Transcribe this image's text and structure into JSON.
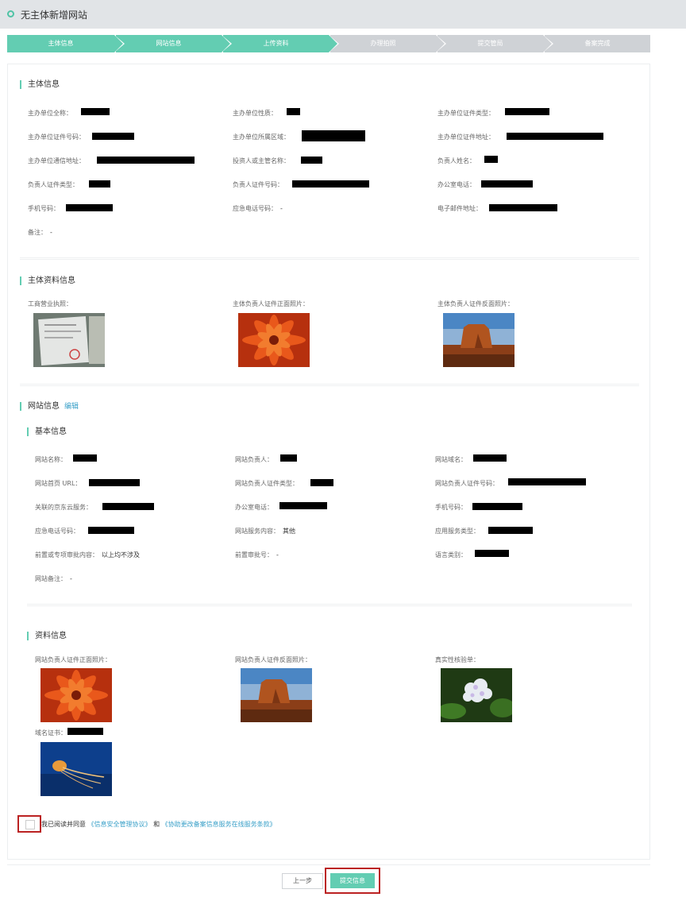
{
  "header": {
    "title": "无主体新增网站"
  },
  "steps": [
    {
      "label": "主体信息",
      "done": true
    },
    {
      "label": "网站信息",
      "done": true
    },
    {
      "label": "上传资料",
      "done": true
    },
    {
      "label": "办理拍照",
      "done": false
    },
    {
      "label": "提交管局",
      "done": false
    },
    {
      "label": "备案完成",
      "done": false
    }
  ],
  "colors": {
    "accent": "#63cdb2",
    "link": "#3aa0c8",
    "inactive_step": "#cfd2d6",
    "highlight_border": "#bb2222"
  },
  "subject_info": {
    "title": "主体信息",
    "fields": {
      "org_name": "主办单位全称：",
      "org_nature": "主办单位性质：",
      "org_cert_type": "主办单位证件类型：",
      "org_cert_no": "主办单位证件号码：",
      "org_region": "主办单位所属区域：",
      "org_cert_addr": "主办单位证件地址：",
      "org_mail_addr": "主办单位通信地址：",
      "investor": "投资人或主管名称：",
      "owner_name": "负责人姓名：",
      "owner_cert_type": "负责人证件类型：",
      "owner_cert_no": "负责人证件号码：",
      "office_phone": "办公室电话：",
      "mobile": "手机号码：",
      "emergency_phone": "应急电话号码：",
      "emergency_phone_value": "-",
      "email": "电子邮件地址：",
      "remark": "备注：",
      "remark_value": "-"
    }
  },
  "subject_docs": {
    "title": "主体资料信息",
    "items": {
      "license": "工商营业执照：",
      "cert_front": "主体负责人证件正面照片：",
      "cert_back": "主体负责人证件反面照片："
    }
  },
  "website_info": {
    "title": "网站信息",
    "edit": "编辑",
    "basic_title": "基本信息",
    "fields": {
      "site_name": "网站名称：",
      "site_owner": "网站负责人：",
      "domain": "网站域名：",
      "home_url": "网站首页 URL：",
      "owner_cert_type": "网站负责人证件类型：",
      "owner_cert_no": "网站负责人证件号码：",
      "jd_service": "关联的京东云服务：",
      "office_phone": "办公室电话：",
      "mobile": "手机号码：",
      "emergency_phone": "应急电话号码：",
      "service_content": "网站服务内容：",
      "service_content_value": "其他",
      "app_service_type": "应用服务类型：",
      "pre_approval": "前置或专项审批内容：",
      "pre_approval_value": "以上均不涉及",
      "pre_approval_no": "前置审批号：",
      "pre_approval_no_value": "-",
      "language": "语言类别：",
      "remark": "网站备注：",
      "remark_value": "-"
    },
    "docs_title": "资料信息",
    "docs": {
      "cert_front": "网站负责人证件正面照片：",
      "cert_back": "网站负责人证件反面照片：",
      "verify_sheet": "真实性核验单：",
      "domain_cert": "域名证书："
    }
  },
  "agreement": {
    "prefix": "我已阅读并同意",
    "link1": "《信息安全管理协议》",
    "and": "和",
    "link2": "《协助更改备案信息服务在线服务条款》",
    "checked": false
  },
  "footer": {
    "prev": "上一步",
    "submit": "提交信息"
  }
}
